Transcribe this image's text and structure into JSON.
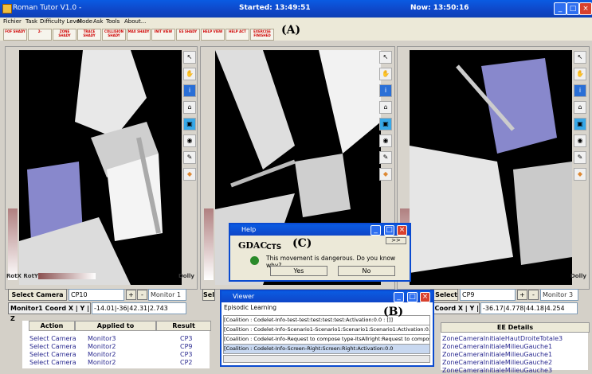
{
  "window": {
    "title": "Roman Tutor V1.0 -",
    "started": "Started: 13:49:51",
    "now": "Now: 13:50:16"
  },
  "menu": [
    "Fichier",
    "Task",
    "Difficulty Level",
    "Mode",
    "Ask",
    "Tools",
    "About..."
  ],
  "toolbar": [
    {
      "label": "FOF SHADY"
    },
    {
      "label": "2-"
    },
    {
      "label": "ZONE SHADY"
    },
    {
      "label": "TRACE SHADY"
    },
    {
      "label": "COLLISION SHADY"
    },
    {
      "label": "MAX SHADY"
    },
    {
      "label": "INIT VIEW"
    },
    {
      "label": "ES SHADY"
    },
    {
      "label": "HELP VIEW"
    },
    {
      "label": "HELP ACT"
    },
    {
      "label": "EXERCISE FINISHED"
    }
  ],
  "markers": {
    "a": "(A)",
    "b": "(B)",
    "c": "(C)"
  },
  "viewport": {
    "rot_label": "RotX RotY",
    "dolly": "Dolly",
    "dolly_right": "Dolly"
  },
  "camera_left": {
    "select": "Select Camera",
    "camera": "CP10",
    "plus": "+",
    "minus": "-",
    "monitor": "Monitor 1",
    "coord_label": "Monitor1 Coord X | Y | Z",
    "coord": "-14.01|-36|42.31|2.743"
  },
  "camera_right": {
    "select": "Select Camera",
    "select_left_partial": "Sele",
    "camera": "CP9",
    "plus": "+",
    "minus": "-",
    "monitor": "Monitor 3",
    "coord_label": "Coord X | Y | Z",
    "coord": "-36.17|4.778|44.18|4.254"
  },
  "action_table": {
    "headers": [
      "Action",
      "Applied to",
      "Result"
    ],
    "rows": [
      [
        "Select Camera",
        "Monitor3",
        "CP3"
      ],
      [
        "Select Camera",
        "Monitor2",
        "CP9"
      ],
      [
        "Select Camera",
        "Monitor2",
        "CP3"
      ],
      [
        "Select Camera",
        "Monitor2",
        "CP2"
      ]
    ]
  },
  "help": {
    "title": "Help",
    "logo": "GDAC",
    "cts": "CTS",
    "message": "This movement is dangerous. Do you know why?",
    "yes": "Yes",
    "no": "No",
    "arrow": ">>"
  },
  "viewer": {
    "title": "Viewer",
    "section": "Episodic Learning",
    "rows": [
      "[Coalition : Codelet-Info-test-test:test:test:test:Activation:0.0 : []]",
      "[Coalition : Codelet-Info-Scenario1-Scenario1:Scenario1:Scenario1:Activation:0.0",
      "[Coalition : Codelet-Info-Request to compose type-ItsAllright:Request to compose",
      "[Coalition : Codelet-Info-Screen-Right:Screen:Right:Activation:0.0"
    ]
  },
  "ee": {
    "header": "EE Details",
    "items": [
      "ZoneCameraInitialeHautDroiteTotale3",
      "ZoneCameraInitialeMilieuGauche1",
      "ZoneCameraInitialeMilieuGauche1",
      "ZoneCameraInitialeMilieuGauche2",
      "ZoneCameraInitialeMilieuGauche3"
    ]
  }
}
